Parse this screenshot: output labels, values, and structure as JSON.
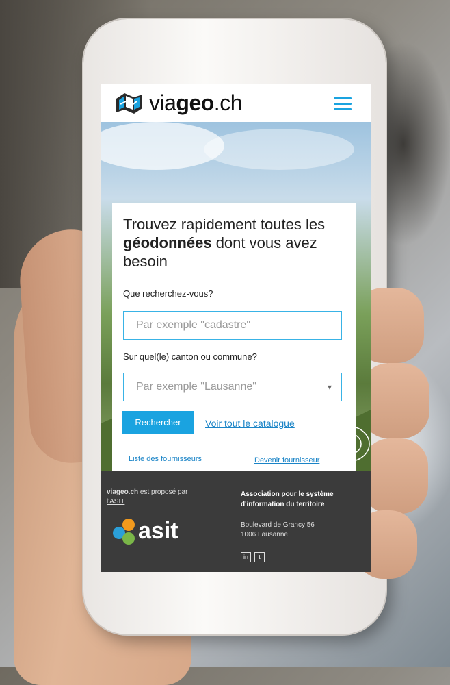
{
  "header": {
    "brand_prefix": "via",
    "brand_bold": "geo",
    "brand_suffix": ".ch"
  },
  "search": {
    "headline_line1": "Trouvez rapidement toutes les",
    "headline_bold": "géodonnées",
    "headline_rest": " dont vous avez besoin",
    "what_label": "Que recherchez-vous?",
    "what_placeholder": "Par exemple \"cadastre\"",
    "where_label": "Sur quel(le) canton ou commune?",
    "where_placeholder": "Par exemple \"Lausanne\"",
    "submit_label": "Rechercher",
    "catalogue_link": "Voir tout le catalogue",
    "providers_link": "Liste des fournisseurs",
    "become_provider_link": "Devenir fournisseur"
  },
  "footer": {
    "site": "viageo.ch",
    "proposed_by": " est proposé par",
    "asit_link": "l'ASIT",
    "asit_logo_text": "asit",
    "association_name": "Association pour le système d'information du territoire",
    "address_line1": "Boulevard de Grancy 56",
    "address_line2": "1006 Lausanne",
    "social": [
      {
        "icon": "linkedin-icon",
        "glyph": "in"
      },
      {
        "icon": "twitter-icon",
        "glyph": "t"
      }
    ]
  },
  "colors": {
    "accent": "#1aa3e0",
    "footer_bg": "#3b3b3b",
    "link": "#1a84c7"
  }
}
